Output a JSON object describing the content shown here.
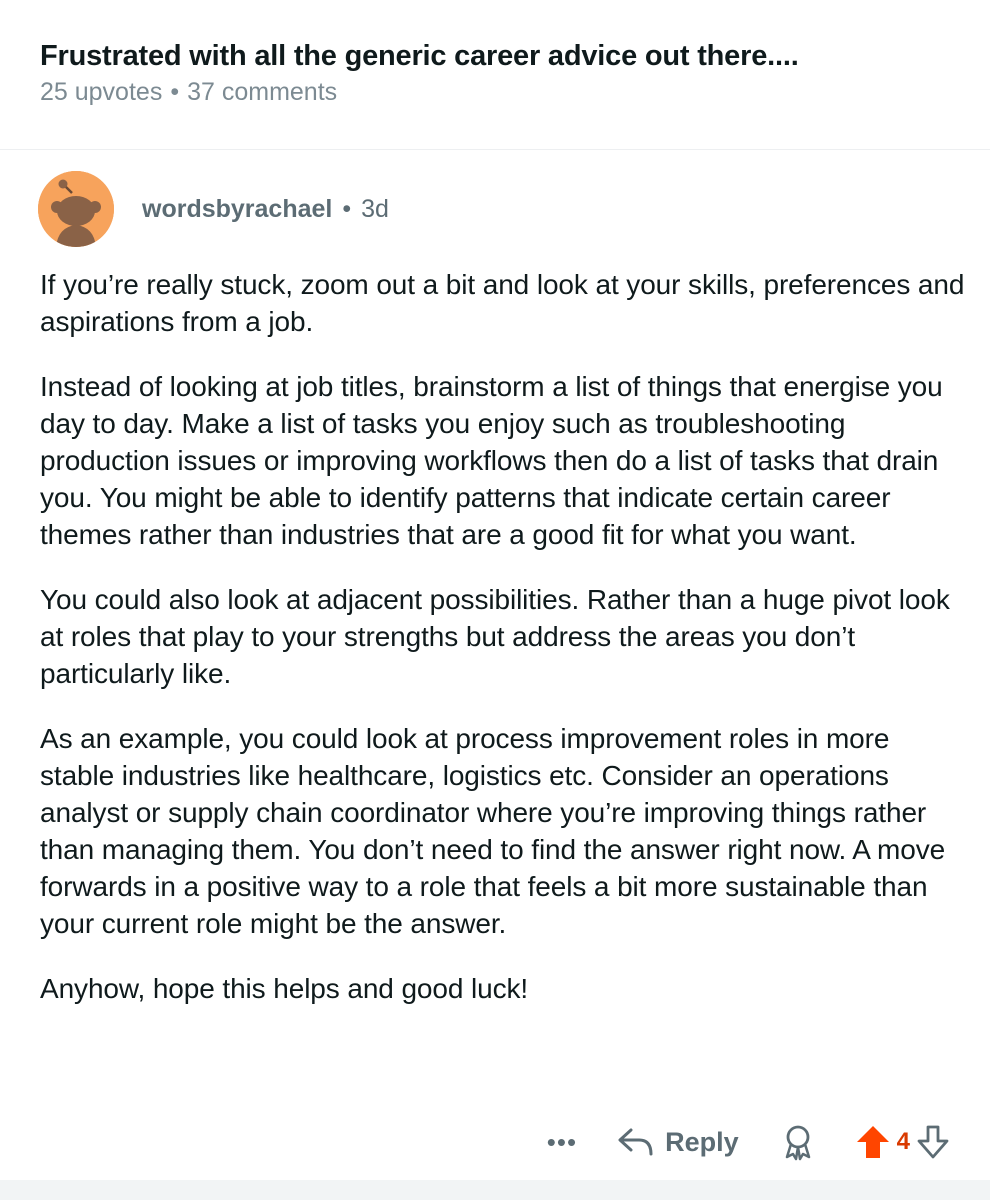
{
  "post": {
    "title": "Frustrated with all the generic career advice out there....",
    "upvotes": "25 upvotes",
    "separator": "•",
    "comments": "37 comments"
  },
  "comment": {
    "author": "wordsbyrachael",
    "separator": "•",
    "age": "3d",
    "paragraphs": [
      "If you’re really stuck, zoom out a bit and look at your skills, preferences and aspirations from a job.",
      "Instead of looking at job titles, brainstorm a list of things that energise you day to day. Make a list of tasks you enjoy such as troubleshooting production issues or improving workflows then do a list of tasks that drain you. You might be able to identify patterns that indicate certain career themes rather than industries that are a good fit for what you want.",
      "You could also look at adjacent possibilities. Rather than a huge pivot look at roles that play to your strengths but address the areas you don’t particularly like.",
      "As an example, you could look at process improvement roles in more stable industries like healthcare, logistics etc. Consider an operations analyst or supply chain coordinator where you’re improving things rather than managing them. You don’t need to find the answer right now. A move forwards in a positive way to a role that feels a bit more sustainable than your current role might be the answer.",
      "Anyhow, hope this helps and good luck!"
    ]
  },
  "actions": {
    "more": "•••",
    "reply_label": "Reply",
    "reply_icon": "reply-arrow-icon",
    "award_icon": "award-icon",
    "upvote_icon": "upvote-arrow-icon",
    "downvote_icon": "downvote-arrow-icon",
    "vote_count": "4"
  },
  "colors": {
    "upvote_active": "#ff4500",
    "vote_count": "#d93a00",
    "meta_text": "#5c6c74",
    "avatar_bg": "#f7a35c"
  }
}
